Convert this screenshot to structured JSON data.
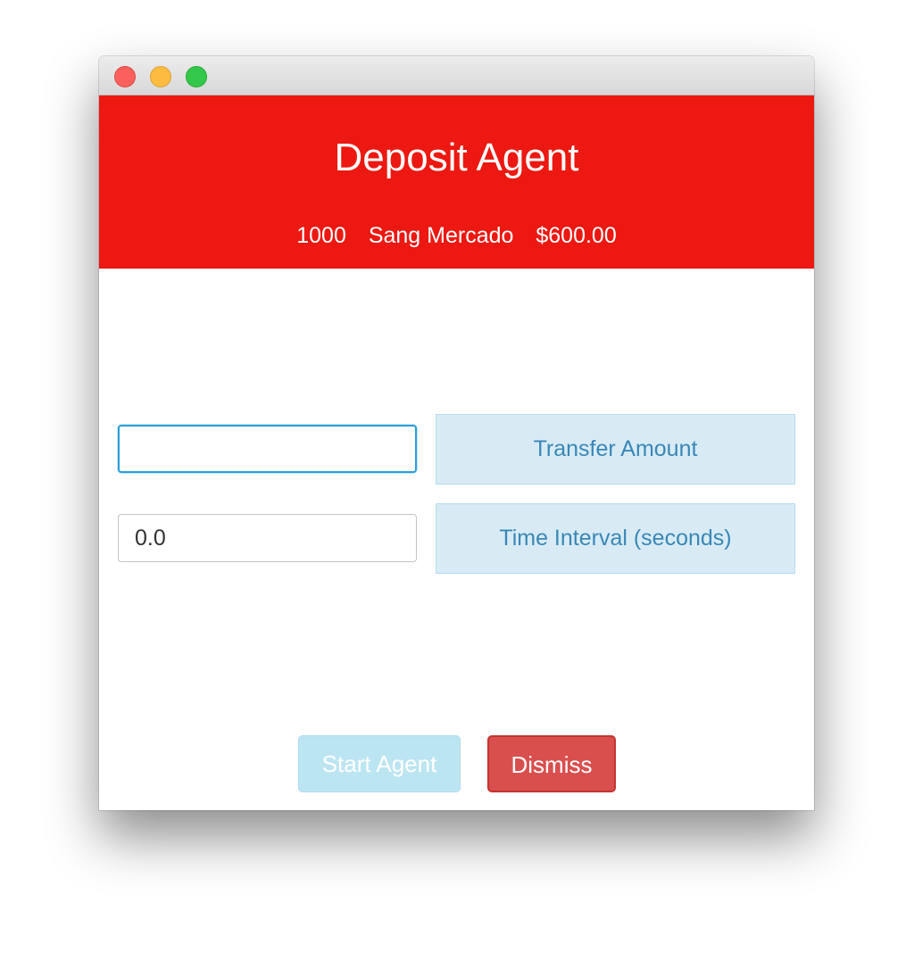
{
  "window": {
    "controls": [
      "close",
      "minimize",
      "maximize"
    ]
  },
  "header": {
    "title": "Deposit Agent",
    "account_number": "1000",
    "account_name": "Sang Mercado",
    "balance": "$600.00",
    "background_color": "#ec1811"
  },
  "form": {
    "transfer_amount": {
      "value": "",
      "label": "Transfer Amount"
    },
    "time_interval": {
      "value": "0.0",
      "label": "Time Interval (seconds)"
    }
  },
  "buttons": {
    "start_label": "Start Agent",
    "dismiss_label": "Dismiss"
  }
}
